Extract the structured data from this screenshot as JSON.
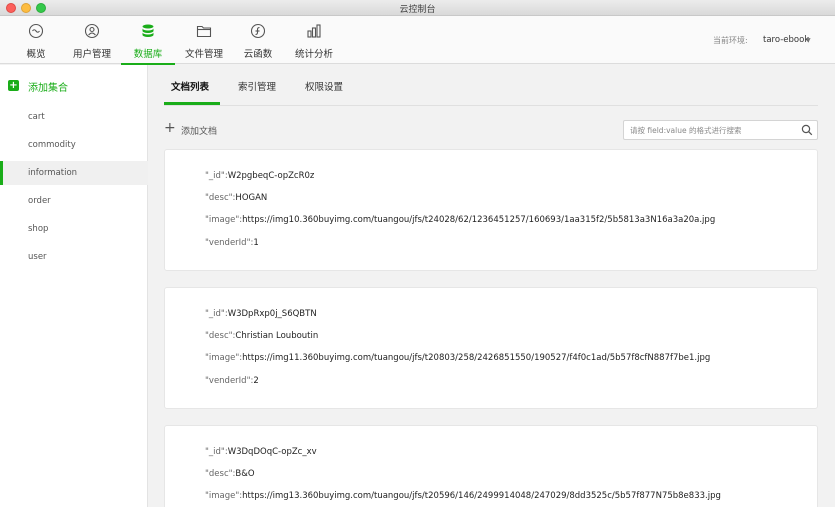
{
  "window": {
    "title": "云控制台"
  },
  "toolbar": {
    "items": [
      {
        "label": "概览",
        "icon": "overview-icon"
      },
      {
        "label": "用户管理",
        "icon": "user-management-icon"
      },
      {
        "label": "数据库",
        "icon": "database-icon",
        "active": true
      },
      {
        "label": "文件管理",
        "icon": "folder-icon"
      },
      {
        "label": "云函数",
        "icon": "cloud-function-icon"
      },
      {
        "label": "统计分析",
        "icon": "statistics-icon"
      }
    ],
    "env_label": "当前环境:",
    "env_value": "taro-ebook"
  },
  "sidebar": {
    "add_collection_label": "添加集合",
    "collections": [
      "cart",
      "commodity",
      "information",
      "order",
      "shop",
      "user"
    ],
    "active_collection": "information"
  },
  "subtabs": [
    "文档列表",
    "索引管理",
    "权限设置"
  ],
  "actions": {
    "add_document_label": "添加文档"
  },
  "search": {
    "placeholder": "请按 field:value 的格式进行搜索"
  },
  "documents": [
    {
      "id_key": "\"_id\":",
      "id": "W2pgbeqC-opZcR0z",
      "desc_key": "\"desc\":",
      "desc": "HOGAN",
      "image_key": "\"image\":",
      "image": "https://img10.360buyimg.com/tuangou/jfs/t24028/62/1236451257/160693/1aa315f2/5b5813a3N16a3a20a.jpg",
      "vender_key": "\"venderId\":",
      "venderId": "1"
    },
    {
      "id_key": "\"_id\":",
      "id": "W3DpRxp0j_S6QBTN",
      "desc_key": "\"desc\":",
      "desc": "Christian Louboutin",
      "image_key": "\"image\":",
      "image": "https://img11.360buyimg.com/tuangou/jfs/t20803/258/2426851550/190527/f4f0c1ad/5b57f8cfN887f7be1.jpg",
      "vender_key": "\"venderId\":",
      "venderId": "2"
    },
    {
      "id_key": "\"_id\":",
      "id": "W3DqDOqC-opZc_xv",
      "desc_key": "\"desc\":",
      "desc": "B&O",
      "image_key": "\"image\":",
      "image": "https://img13.360buyimg.com/tuangou/jfs/t20596/146/2499914048/247029/8dd3525c/5b57f877N75b8e833.jpg",
      "vender_key": "\"venderId\":",
      "venderId": ""
    }
  ],
  "colors": {
    "accent": "#1aad19"
  }
}
